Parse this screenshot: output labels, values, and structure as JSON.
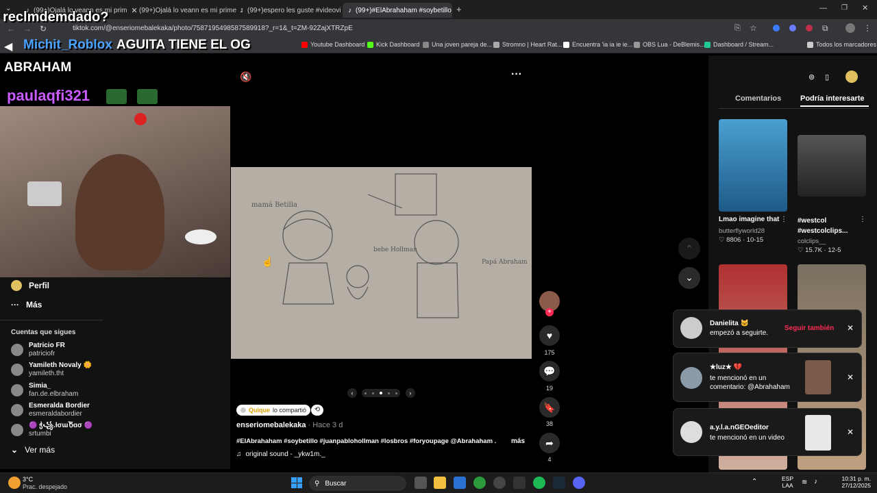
{
  "tabs": [
    {
      "label": "(99+)Ojalá lo veann es mi prim",
      "active": false
    },
    {
      "label": "(99+)Ojalá lo veann es mi prime",
      "active": false
    },
    {
      "label": "(99+)espero les guste #videovi",
      "active": false
    },
    {
      "label": "(99+)#ElAbrahaham #soybetillo",
      "active": true
    }
  ],
  "address": {
    "url": "tiktok.com/@enseriomebalekaka/photo/7587195498587589918?_r=1&_t=ZM-92ZajXTRZpE"
  },
  "bookmarks": [
    {
      "label": "Youtube Dashboard",
      "color": "#ff0000"
    },
    {
      "label": "Kick Dashboard",
      "color": "#53fc18"
    },
    {
      "label": "Una joven pareja de...",
      "color": "#888888"
    },
    {
      "label": "Stromno | Heart Rat...",
      "color": "#aaaaaa"
    },
    {
      "label": "Encuentra 'ia ia ie ie...",
      "color": "#ffffff"
    },
    {
      "label": "OBS Lua - DeBlemis...",
      "color": "#999999"
    },
    {
      "label": "Dashboard / Stream...",
      "color": "#20c997"
    },
    {
      "label": "Todos los marcadores",
      "color": "#cccccc"
    }
  ],
  "overlay": {
    "top_text": "reclmdemdado?",
    "chat_user": "Michit_Roblox",
    "chat_msg": "AGUITA TIENE EL OG",
    "name": "ABRAHAM",
    "user2": "paulaqfi321"
  },
  "sidebar": {
    "perfil": "Perfil",
    "mas": "Más",
    "following_title": "Cuentas que sigues",
    "accounts": [
      {
        "name": "Patricio FR",
        "user": "patriciofr"
      },
      {
        "name": "Yamileth Novaly 🌼",
        "user": "yamileth.tht"
      },
      {
        "name": "Simia_",
        "user": "fan.de.elbraham"
      },
      {
        "name": "Esmeralda Bordier",
        "user": "esmeraldabordier"
      },
      {
        "name": "🟣 ჭ꧁.ƚσɯႦ̃ɑσ 🟣",
        "user": "srtumbi"
      }
    ],
    "ver_mas": "Ver más"
  },
  "photo": {
    "caption_left": "mamá Betilla",
    "caption_mid": "bebe Hollman",
    "caption_right": "Papá Abraham"
  },
  "actions": {
    "likes": "175",
    "comments": "19",
    "saves": "38",
    "shares": "4"
  },
  "post": {
    "shared_by": "Quique",
    "shared_text": "lo compartió",
    "author": "enseriomebalekaka",
    "time": "· Hace 3 d",
    "desc": "#ElAbrahaham #soybetillo #juanpabloholIman #losbros #foryoupage @Abrahaham ...",
    "more": "más",
    "sound": "original sound - _ykw1m._"
  },
  "right_panel": {
    "tab1": "Comentarios",
    "tab2": "Podría interesarte",
    "videos": [
      {
        "title": "Lmao imagine that",
        "user": "butterflyworld28",
        "stats": "8806 · 10-15"
      },
      {
        "title": "#westcol #westcolclips...",
        "user": "colclips__",
        "stats": "15.7K · 12-5"
      }
    ]
  },
  "notifications": [
    {
      "name": "Danielita 🐱",
      "text": "empezó a seguirte.",
      "action": "Seguir también"
    },
    {
      "name": "★luz★ 💔",
      "text": "te mencionó en un comentario: @Abrahaham",
      "action": ""
    },
    {
      "name": "a.y.l.a.nGEOeditor",
      "text": "te mencionó en un video",
      "action": ""
    }
  ],
  "taskbar": {
    "weather_temp": "3°C",
    "weather_desc": "Prac. despejado",
    "search": "Buscar",
    "lang1": "ESP",
    "lang2": "LAA",
    "time": "10:31 p. m.",
    "date": "27/12/2025"
  }
}
